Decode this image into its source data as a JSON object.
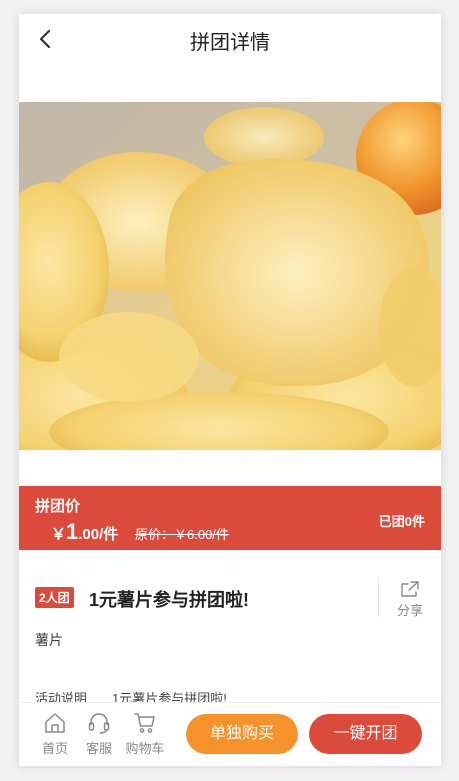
{
  "header": {
    "title": "拼团详情"
  },
  "price_bar": {
    "label": "拼团价",
    "currency": "￥",
    "price_int": "1",
    "price_dec": ".00/件",
    "original_price": "原价：￥6.00/件",
    "joined_count": "已团0件"
  },
  "product": {
    "badge": "2人团",
    "title": "1元薯片参与拼团啦!",
    "share_label": "分享",
    "subtitle": "薯片"
  },
  "activity": {
    "label": "活动说明",
    "text": "1元薯片参与拼团啦!"
  },
  "bottom_nav": {
    "home": "首页",
    "service": "客服",
    "cart": "购物车",
    "buy_single": "单独购买",
    "group_buy": "一键开团"
  },
  "colors": {
    "accent_red": "#dc4a3c",
    "accent_orange": "#f7922a"
  }
}
